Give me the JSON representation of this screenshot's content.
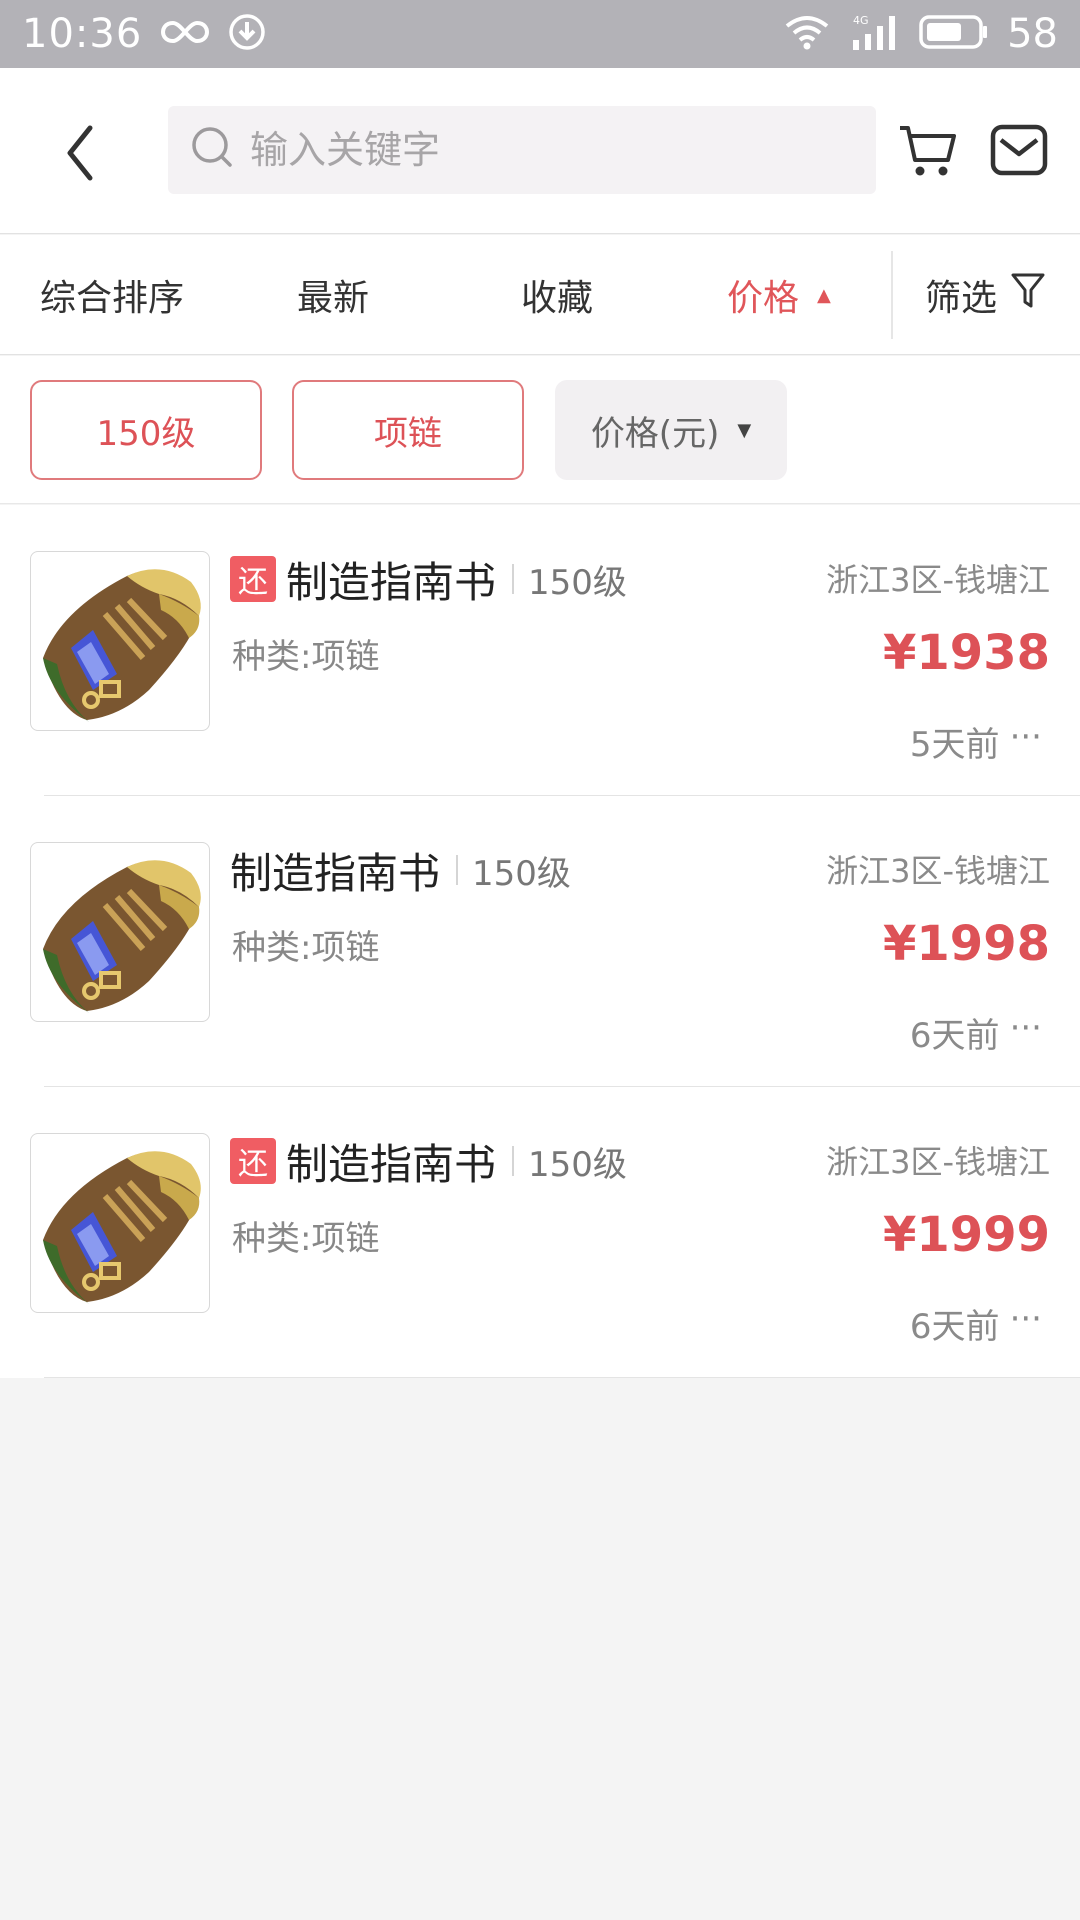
{
  "status_bar": {
    "time": "10:36",
    "battery": "58",
    "icons": [
      "infinity-icon",
      "download-icon",
      "wifi-icon",
      "signal-4g-icon",
      "battery-icon"
    ]
  },
  "header": {
    "search_placeholder": "输入关键字",
    "icons": [
      "back-icon",
      "search-icon",
      "cart-icon",
      "mail-icon"
    ]
  },
  "sort_tabs": [
    {
      "label": "综合排序",
      "active": false
    },
    {
      "label": "最新",
      "active": false
    },
    {
      "label": "收藏",
      "active": false
    },
    {
      "label": "价格",
      "active": true,
      "indicator": "▲"
    }
  ],
  "filter_label": "筛选",
  "chips": [
    {
      "label": "150级",
      "selected": true
    },
    {
      "label": "项链",
      "selected": true
    },
    {
      "label": "价格(元)",
      "selected": false,
      "indicator": "▼"
    }
  ],
  "items": [
    {
      "tag": "还",
      "name": "制造指南书",
      "level": "150级",
      "type": "种类:项链",
      "server": "浙江3区-钱塘江",
      "price": "¥1938",
      "time": "5天前",
      "more": "···"
    },
    {
      "tag": "",
      "name": "制造指南书",
      "level": "150级",
      "type": "种类:项链",
      "server": "浙江3区-钱塘江",
      "price": "¥1998",
      "time": "6天前",
      "more": "···"
    },
    {
      "tag": "还",
      "name": "制造指南书",
      "level": "150级",
      "type": "种类:项链",
      "server": "浙江3区-钱塘江",
      "price": "¥1999",
      "time": "6天前",
      "more": "···"
    }
  ],
  "colors": {
    "accent": "#dd5257",
    "status_bar": "#b3b2b7",
    "tag": "#f05d63",
    "background": "#f4f4f4"
  }
}
